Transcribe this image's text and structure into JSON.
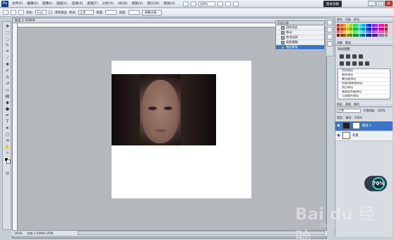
{
  "menubar": {
    "logo": "Ps",
    "items": [
      "文件(F)",
      "编辑(E)",
      "图像(I)",
      "图层(L)",
      "选择(S)",
      "滤镜(T)",
      "分析(A)",
      "3D(D)",
      "视图(V)",
      "窗口(W)",
      "帮助(H)"
    ],
    "zoom": "100%",
    "workspace_label": "基本功能",
    "win_min": "_",
    "win_max": "□",
    "win_close": "×"
  },
  "optbar": {
    "feather_label": "羽化:",
    "feather_value": "0 px",
    "antialias_label": "消除锯齿",
    "style_label": "样式:",
    "style_value": "正常",
    "width_label": "宽度:",
    "height_label": "高度:",
    "refine_label": "调整边缘..."
  },
  "document": {
    "title": "图层 1, RGB/8",
    "zoom_status": "100%",
    "doc_size": "文档:1.05M/1.05M"
  },
  "history": {
    "tab": "历史记录",
    "rows": [
      {
        "label": "扭转选区",
        "active": false
      },
      {
        "label": "移动",
        "active": false
      },
      {
        "label": "取消选择",
        "active": false
      },
      {
        "label": "高斯模糊",
        "active": false
      },
      {
        "label": "图层蒙版",
        "active": true
      }
    ]
  },
  "panels": {
    "color_tabs": [
      "颜色",
      "色板",
      "样式"
    ],
    "adjust_tabs": [
      "调整",
      "蒙版"
    ],
    "adjust_title": "添加调整",
    "presets": [
      "色阶预设",
      "曲线预设",
      "曝光度预设",
      "色相/饱和度预设",
      "黑白预设",
      "通道混合器预设",
      "可选颜色预设"
    ],
    "layer_tabs": [
      "图层",
      "通道",
      "路径"
    ],
    "blend_mode": "正常",
    "opacity_label": "不透明度:",
    "opacity_value": "100%",
    "lock_label": "锁定:",
    "fill_label": "填充:",
    "fill_value": "100%",
    "layers": [
      {
        "name": "图层 1",
        "active": true
      },
      {
        "name": "背景",
        "active": false
      }
    ]
  },
  "overlay": {
    "gauge_value": "70%",
    "watermark": "Bai du 经验",
    "watermark_sub": "jingyan.baidu.com"
  },
  "colors": {
    "accent": "#3a74c8",
    "gauge_ring": "#3fd1c2"
  }
}
